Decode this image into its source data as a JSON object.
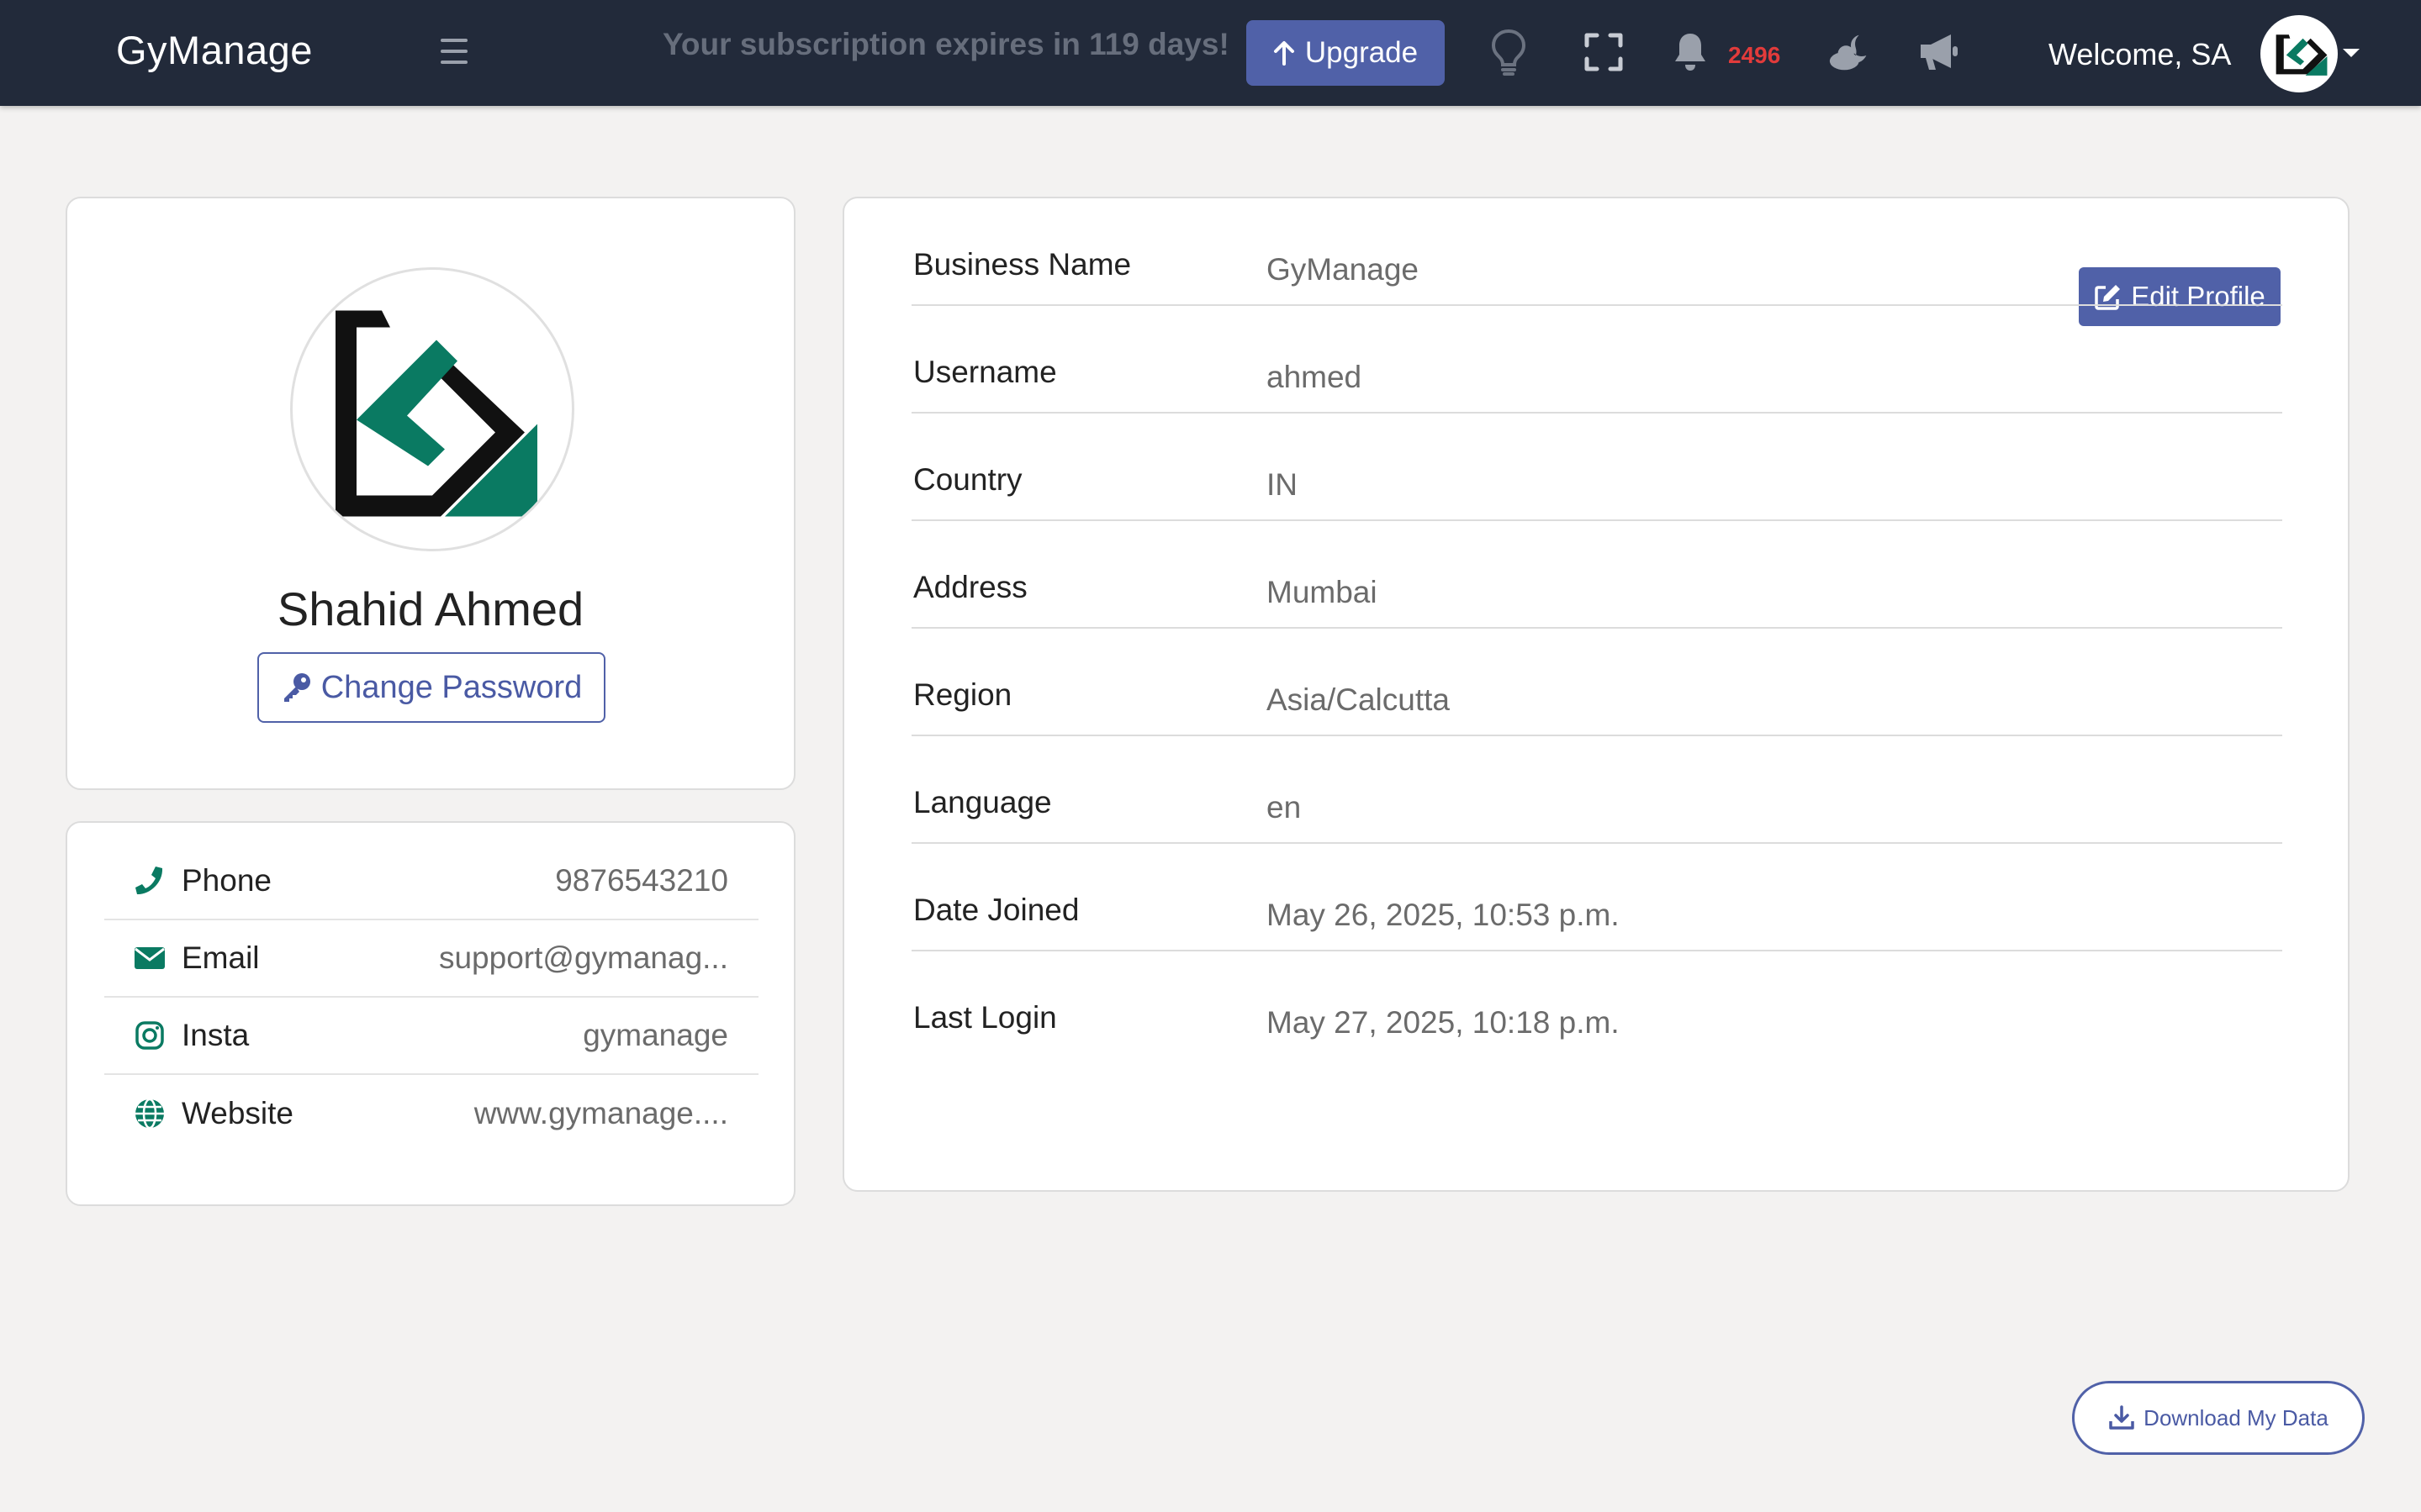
{
  "navbar": {
    "brand": "GyManage",
    "subscription_message": "Your subscription expires in 119 days!",
    "upgrade_label": "Upgrade",
    "notification_count": "2496",
    "welcome_text": "Welcome, SA",
    "icons": [
      "menu-icon",
      "lightbulb-icon",
      "fullscreen-icon",
      "bell-icon",
      "moon-cloud-icon",
      "megaphone-icon"
    ]
  },
  "profile": {
    "name": "Shahid Ahmed",
    "change_password_label": "Change Password"
  },
  "contact": [
    {
      "icon": "phone-icon",
      "label": "Phone",
      "value": "9876543210"
    },
    {
      "icon": "envelope-icon",
      "label": "Email",
      "value": "support@gymanag..."
    },
    {
      "icon": "instagram-icon",
      "label": "Insta",
      "value": "gymanage"
    },
    {
      "icon": "globe-icon",
      "label": "Website",
      "value": "www.gymanage...."
    }
  ],
  "details": {
    "edit_label": "Edit Profile",
    "rows": [
      {
        "label": "Business Name",
        "value": "GyManage"
      },
      {
        "label": "Username",
        "value": "ahmed"
      },
      {
        "label": "Country",
        "value": "IN"
      },
      {
        "label": "Address",
        "value": "Mumbai"
      },
      {
        "label": "Region",
        "value": "Asia/Calcutta"
      },
      {
        "label": "Language",
        "value": "en"
      },
      {
        "label": "Date Joined",
        "value": "May 26, 2025, 10:53 p.m."
      },
      {
        "label": "Last Login",
        "value": "May 27, 2025, 10:18 p.m."
      }
    ]
  },
  "download_label": "Download My Data",
  "colors": {
    "navbar": "#222a3a",
    "primary": "#5061a8",
    "accent_green": "#0a7a62",
    "badge_red": "#e23b3b",
    "background": "#f3f2f1"
  }
}
